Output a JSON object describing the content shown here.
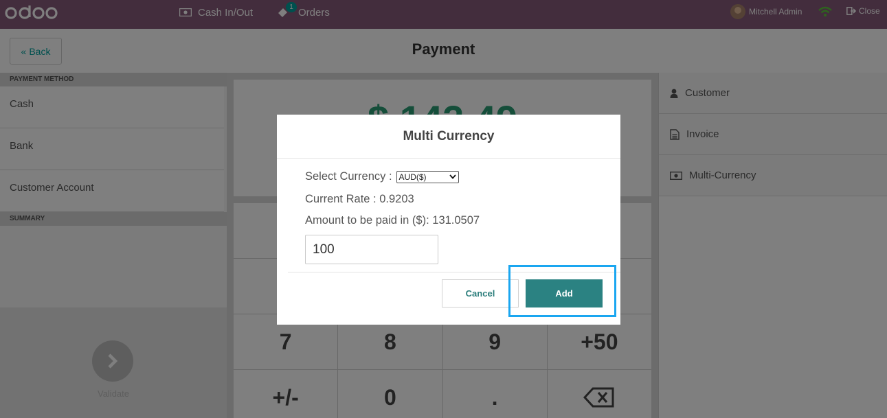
{
  "topbar": {
    "logo": "odoo",
    "cash_label": "Cash In/Out",
    "orders_label": "Orders",
    "orders_count": "1",
    "user_name": "Mitchell Admin",
    "close_label": "Close"
  },
  "header": {
    "back_label": "Back",
    "title": "Payment"
  },
  "left_panel": {
    "payment_method_title": "PAYMENT METHOD",
    "methods": [
      "Cash",
      "Bank",
      "Customer Account"
    ],
    "summary_title": "SUMMARY",
    "validate_label": "Validate"
  },
  "center_panel": {
    "amount": "$ 142.49",
    "keys": [
      "7",
      "8",
      "9",
      "+50",
      "+/-",
      "0",
      ".",
      "backspace"
    ]
  },
  "right_panel": {
    "items": [
      "Customer",
      "Invoice",
      "Multi-Currency"
    ]
  },
  "modal": {
    "title": "Multi Currency",
    "select_label": "Select Currency :",
    "selected_currency": "AUD($)",
    "rate_label": "Current Rate : 0.9203",
    "amount_label": "Amount to be paid in ($): 131.0507",
    "input_value": "100",
    "cancel_label": "Cancel",
    "add_label": "Add"
  },
  "colors": {
    "topbar": "#875a7b",
    "accent": "#2b8282",
    "highlight": "#1aa6f0",
    "amount": "#2a9d74"
  }
}
